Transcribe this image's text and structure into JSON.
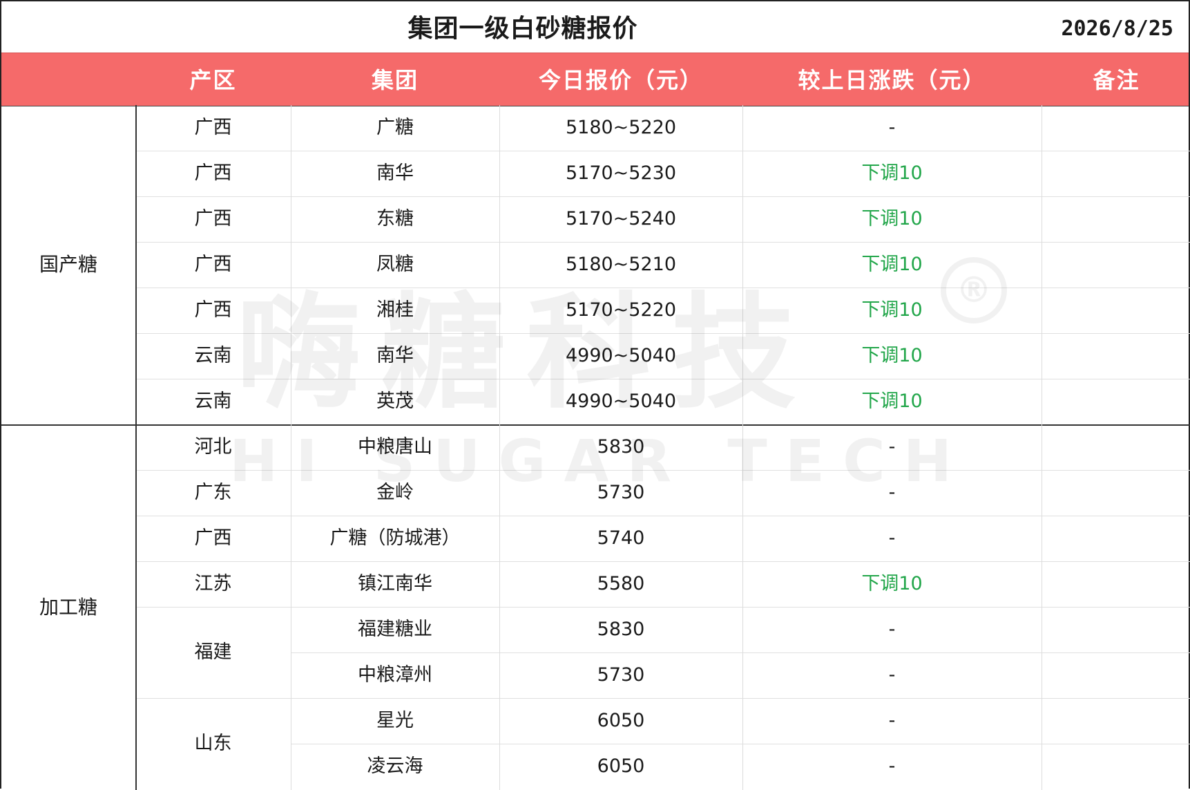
{
  "title": "集团一级白砂糖报价",
  "date": "2026/8/25",
  "headers": {
    "region": "产区",
    "group": "集团",
    "price": "今日报价（元）",
    "change": "较上日涨跌（元）",
    "note": "备注"
  },
  "categories": {
    "domestic": "国产糖",
    "processed": "加工糖"
  },
  "rows": [
    {
      "region": "广西",
      "group": "广糖",
      "price": "5180~5220",
      "change": "-"
    },
    {
      "region": "广西",
      "group": "南华",
      "price": "5170~5230",
      "change": "下调10"
    },
    {
      "region": "广西",
      "group": "东糖",
      "price": "5170~5240",
      "change": "下调10"
    },
    {
      "region": "广西",
      "group": "凤糖",
      "price": "5180~5210",
      "change": "下调10"
    },
    {
      "region": "广西",
      "group": "湘桂",
      "price": "5170~5220",
      "change": "下调10"
    },
    {
      "region": "云南",
      "group": "南华",
      "price": "4990~5040",
      "change": "下调10"
    },
    {
      "region": "云南",
      "group": "英茂",
      "price": "4990~5040",
      "change": "下调10"
    },
    {
      "region": "河北",
      "group": "中粮唐山",
      "price": "5830",
      "change": "-"
    },
    {
      "region": "广东",
      "group": "金岭",
      "price": "5730",
      "change": "-"
    },
    {
      "region": "广西",
      "group": "广糖（防城港）",
      "price": "5740",
      "change": "-"
    },
    {
      "region": "江苏",
      "group": "镇江南华",
      "price": "5580",
      "change": "下调10"
    },
    {
      "region": "福建",
      "group": "福建糖业",
      "price": "5830",
      "change": "-"
    },
    {
      "region": "",
      "group": "中粮漳州",
      "price": "5730",
      "change": "-"
    },
    {
      "region": "山东",
      "group": "星光",
      "price": "6050",
      "change": "-"
    },
    {
      "region": "",
      "group": "凌云海",
      "price": "6050",
      "change": "-"
    }
  ],
  "watermark": {
    "cn": "嗨糖科技",
    "en": "HI SUGAR TECH",
    "reg": "®"
  },
  "colors": {
    "header_bg": "#f56a6a",
    "header_text": "#ffffff",
    "down": "#22a64a"
  }
}
